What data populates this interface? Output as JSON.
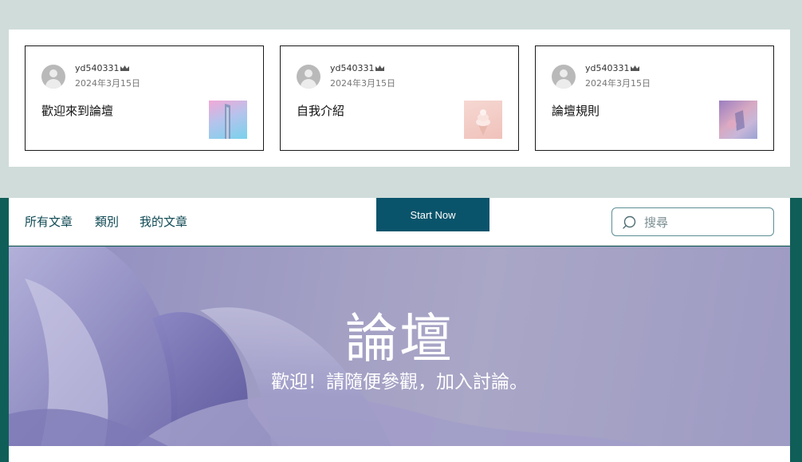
{
  "posts": [
    {
      "author": "yd540331",
      "date": "2024年3月15日",
      "title": "歡迎來到論壇",
      "badge_icon": "crown-icon",
      "thumbnail": "tower-image"
    },
    {
      "author": "yd540331",
      "date": "2024年3月15日",
      "title": "自我介紹",
      "badge_icon": "crown-icon",
      "thumbnail": "ice-cream-image"
    },
    {
      "author": "yd540331",
      "date": "2024年3月15日",
      "title": "論壇規則",
      "badge_icon": "crown-icon",
      "thumbnail": "abstract-image"
    }
  ],
  "nav": {
    "items": [
      "所有文章",
      "類別",
      "我的文章"
    ],
    "start_label": "Start Now",
    "search_placeholder": "搜尋"
  },
  "hero": {
    "title": "論壇",
    "subtitle": "歡迎！請隨便參觀，加入討論。"
  },
  "colors": {
    "accent": "#0a546b",
    "nav_text": "#0f4a54",
    "outer_bg": "#cfdcda",
    "side_bg": "#0f5f58"
  }
}
